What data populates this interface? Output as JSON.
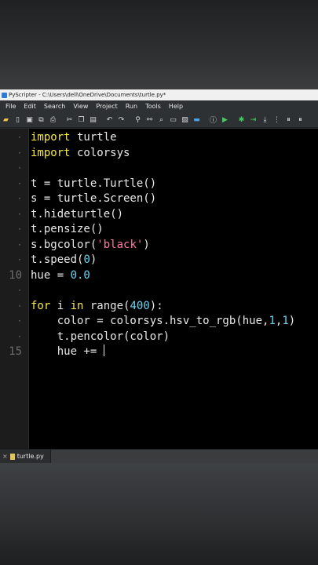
{
  "window": {
    "title": "PyScripter - C:\\Users\\dell\\OneDrive\\Documents\\turtle.py*"
  },
  "menu": [
    "File",
    "Edit",
    "Search",
    "View",
    "Project",
    "Run",
    "Tools",
    "Help"
  ],
  "toolbar_icons": [
    "open-folder-icon",
    "new-file-icon",
    "save-icon",
    "save-all-icon",
    "print-icon",
    "cut-icon",
    "copy-icon",
    "paste-icon",
    "undo-icon",
    "redo-icon",
    "search-icon",
    "replace-icon",
    "find-in-files-icon",
    "zoom-icon",
    "image-icon",
    "terminal-icon",
    "info-icon",
    "run-icon",
    "debug-icon",
    "step-over-icon",
    "step-into-icon",
    "more-icon"
  ],
  "gutter": {
    "line10": "10",
    "line15": "15"
  },
  "code": {
    "l1_kw": "import",
    "l1_rest": " turtle",
    "l2_kw": "import",
    "l2_rest": " colorsys",
    "l4": "t = turtle.Turtle()",
    "l5": "s = turtle.Screen()",
    "l6": "t.hideturtle()",
    "l7": "t.pensize()",
    "l8_a": "s.bgcolor(",
    "l8_str": "'black'",
    "l8_b": ")",
    "l9_a": "t.speed(",
    "l9_num": "0",
    "l9_b": ")",
    "l10_a": "hue = ",
    "l10_num": "0.0",
    "l12_kw1": "for",
    "l12_a": " i ",
    "l12_kw2": "in",
    "l12_b": " range(",
    "l12_num": "400",
    "l12_c": "):",
    "l13_a": "    color = colorsys.hsv_to_rgb(hue,",
    "l13_n1": "1",
    "l13_b": ",",
    "l13_n2": "1",
    "l13_c": ")",
    "l14": "    t.pencolor(color)",
    "l15": "    hue += "
  },
  "tab": {
    "label": "turtle.py"
  }
}
